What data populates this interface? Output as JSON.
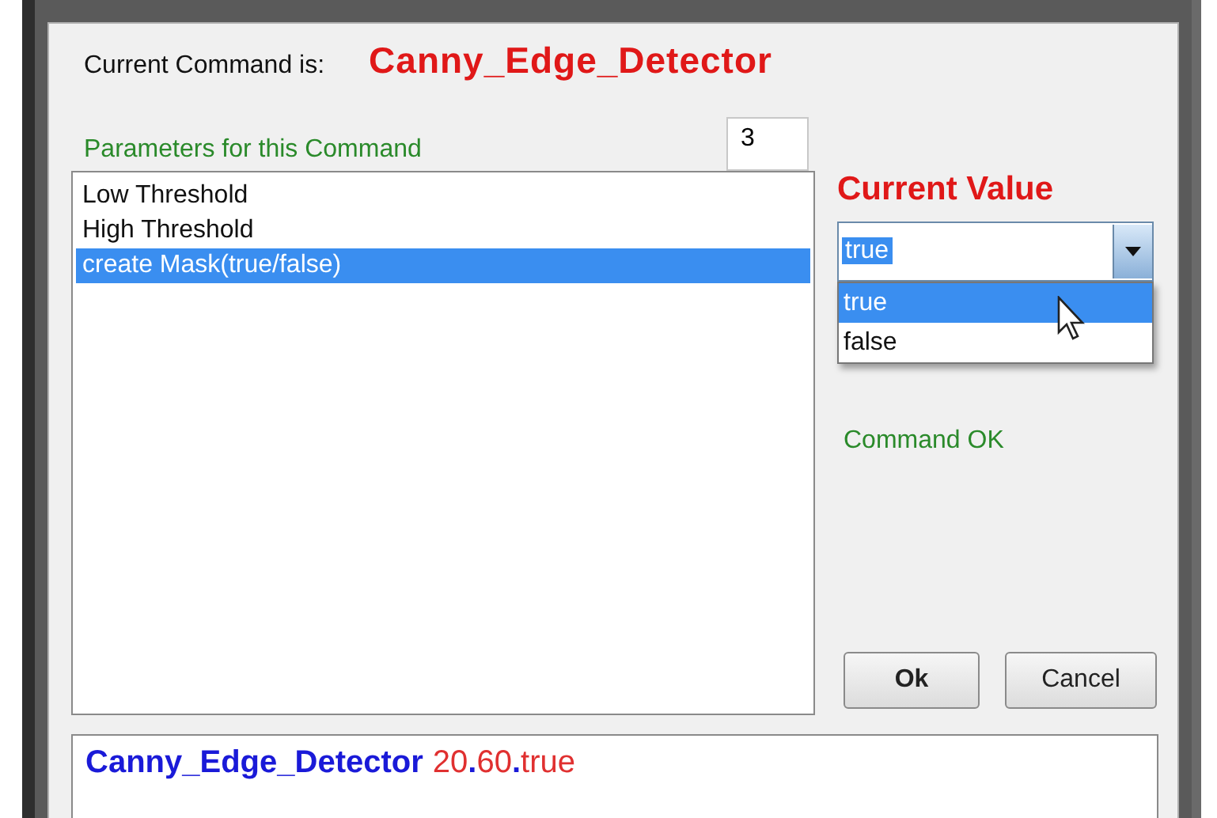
{
  "current_command": {
    "label": "Current Command is:",
    "value": "Canny_Edge_Detector"
  },
  "parameters": {
    "label": "Parameters for this Command",
    "count": "3"
  },
  "parameter_list": [
    {
      "label": "Low Threshold",
      "selected": false
    },
    {
      "label": "High Threshold",
      "selected": false
    },
    {
      "label": "create Mask(true/false)",
      "selected": true
    }
  ],
  "current_value": {
    "label": "Current Value",
    "value": "true",
    "expanded": true,
    "options": [
      {
        "label": "true",
        "selected": true
      },
      {
        "label": "false",
        "selected": false
      }
    ]
  },
  "status": "Command OK",
  "buttons": [
    {
      "label": "Ok",
      "kind": "default"
    },
    {
      "label": "Cancel",
      "kind": "normal"
    }
  ],
  "command_line": [
    {
      "text": "Canny_Edge_Detector",
      "kind": "command"
    },
    {
      "text": "20",
      "kind": "param"
    },
    {
      "text": ".",
      "kind": "separator"
    },
    {
      "text": "60",
      "kind": "param"
    },
    {
      "text": ".",
      "kind": "separator"
    },
    {
      "text": "true",
      "kind": "param"
    }
  ]
}
